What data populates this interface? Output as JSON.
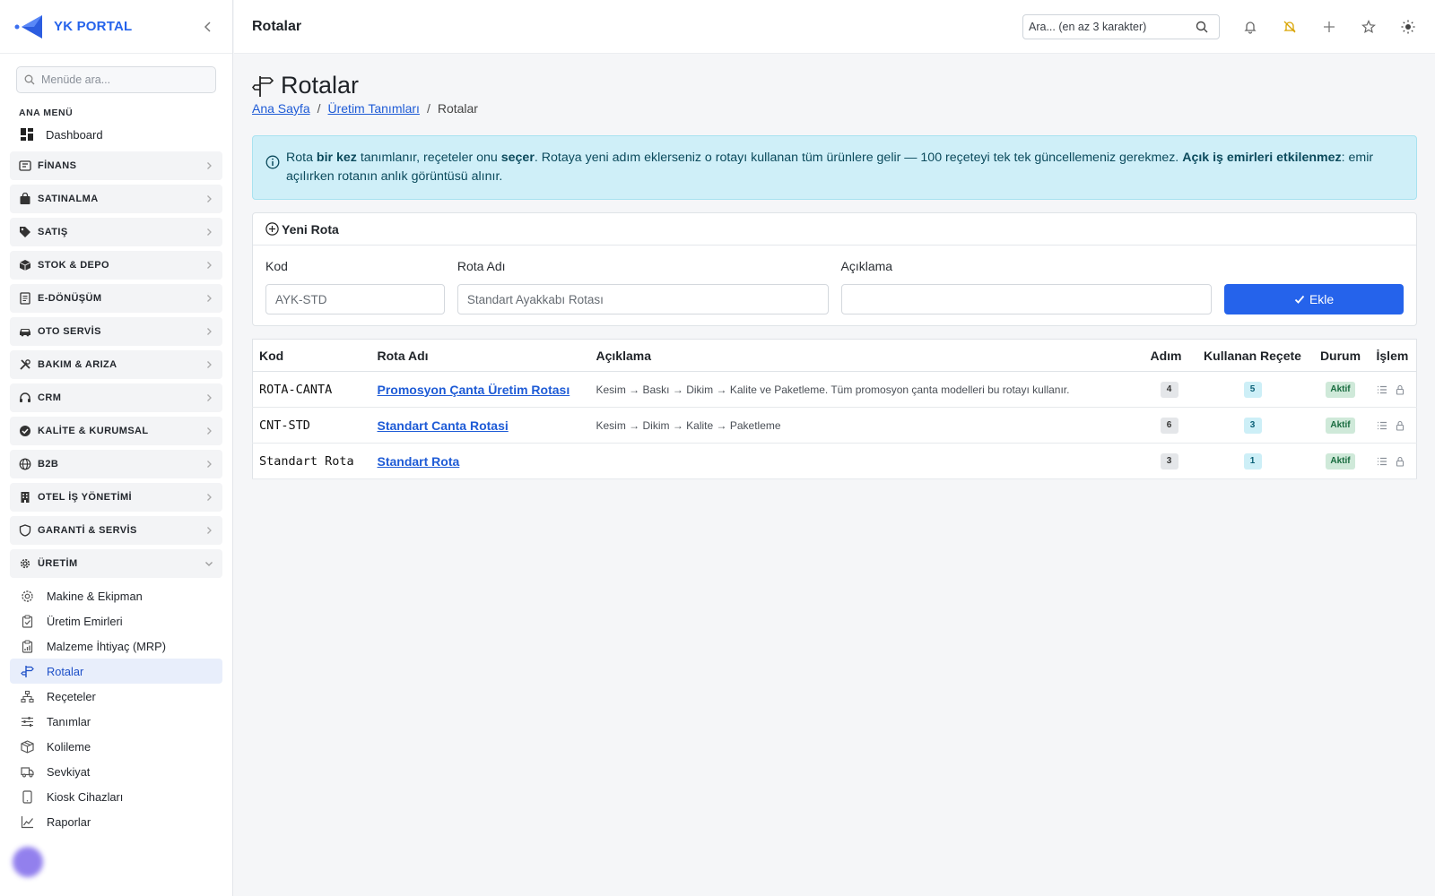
{
  "brand": {
    "name": "YK PORTAL"
  },
  "sidebar": {
    "search_placeholder": "Menüde ara...",
    "menu_label": "ANA MENÜ",
    "dashboard": "Dashboard",
    "groups": [
      {
        "label": "FİNANS",
        "icon": "finance-icon"
      },
      {
        "label": "SATINALMA",
        "icon": "bag-icon"
      },
      {
        "label": "SATIŞ",
        "icon": "tag-icon"
      },
      {
        "label": "STOK & DEPO",
        "icon": "box-icon"
      },
      {
        "label": "E-DÖNÜŞÜM",
        "icon": "document-icon"
      },
      {
        "label": "OTO SERVİS",
        "icon": "car-icon"
      },
      {
        "label": "BAKIM & ARIZA",
        "icon": "tools-icon"
      },
      {
        "label": "CRM",
        "icon": "headset-icon"
      },
      {
        "label": "KALİTE & KURUMSAL",
        "icon": "badge-check-icon"
      },
      {
        "label": "B2B",
        "icon": "globe-icon"
      },
      {
        "label": "OTEL İŞ YÖNETİMİ",
        "icon": "building-icon"
      },
      {
        "label": "GARANTİ & SERVİS",
        "icon": "shield-icon"
      },
      {
        "label": "ÜRETİM",
        "icon": "gear-icon"
      }
    ],
    "production_items": [
      {
        "label": "Makine & Ekipman",
        "icon": "machine-gear-icon"
      },
      {
        "label": "Üretim Emirleri",
        "icon": "clipboard-icon"
      },
      {
        "label": "Malzeme İhtiyaç (MRP)",
        "icon": "clipboard-chart-icon"
      },
      {
        "label": "Rotalar",
        "icon": "signpost-icon"
      },
      {
        "label": "Reçeteler",
        "icon": "hierarchy-icon"
      },
      {
        "label": "Tanımlar",
        "icon": "sliders-icon"
      },
      {
        "label": "Kolileme",
        "icon": "package-icon"
      },
      {
        "label": "Sevkiyat",
        "icon": "truck-icon"
      },
      {
        "label": "Kiosk Cihazları",
        "icon": "tablet-icon"
      },
      {
        "label": "Raporlar",
        "icon": "graph-icon"
      }
    ]
  },
  "topbar": {
    "title": "Rotalar",
    "search_placeholder": "Ara... (en az 3 karakter)"
  },
  "page": {
    "title": "Rotalar",
    "breadcrumb": [
      "Ana Sayfa",
      "Üretim Tanımları",
      "Rotalar"
    ]
  },
  "alert": {
    "t1": "Rota ",
    "b1": "bir kez",
    "t2": " tanımlanır, reçeteler onu ",
    "b2": "seçer",
    "t3": ". Rotaya yeni adım eklerseniz o rotayı kullanan tüm ürünlere gelir — 100 reçeteyi tek tek güncellemeniz gerekmez. ",
    "b3": "Açık iş emirleri etkilenmez",
    "t4": ": emir açılırken rotanın anlık görüntüsü alınır."
  },
  "form": {
    "header": "Yeni Rota",
    "kod_label": "Kod",
    "kod_placeholder": "AYK-STD",
    "name_label": "Rota Adı",
    "name_placeholder": "Standart Ayakkabı Rotası",
    "desc_label": "Açıklama",
    "desc_value": "",
    "submit": "Ekle"
  },
  "table": {
    "headers": [
      "Kod",
      "Rota Adı",
      "Açıklama",
      "Adım",
      "Kullanan Reçete",
      "Durum",
      "İşlem"
    ],
    "rows": [
      {
        "kod": "ROTA-CANTA",
        "name": "Promosyon Çanta Üretim Rotası",
        "desc": "Kesim → Baskı → Dikim → Kalite ve Paketleme. Tüm promosyon çanta modelleri bu rotayı kullanır.",
        "steps": "4",
        "recipes": "5",
        "status": "Aktif"
      },
      {
        "kod": "CNT-STD",
        "name": "Standart Canta Rotasi",
        "desc": "Kesim → Dikim → Kalite → Paketleme",
        "steps": "6",
        "recipes": "3",
        "status": "Aktif"
      },
      {
        "kod": "Standart Rota",
        "name": "Standart Rota",
        "desc": "",
        "steps": "3",
        "recipes": "1",
        "status": "Aktif"
      }
    ]
  },
  "colors": {
    "accent": "#2563eb",
    "alert_bg": "#cfeff8",
    "active_bg": "#e8eefb"
  }
}
